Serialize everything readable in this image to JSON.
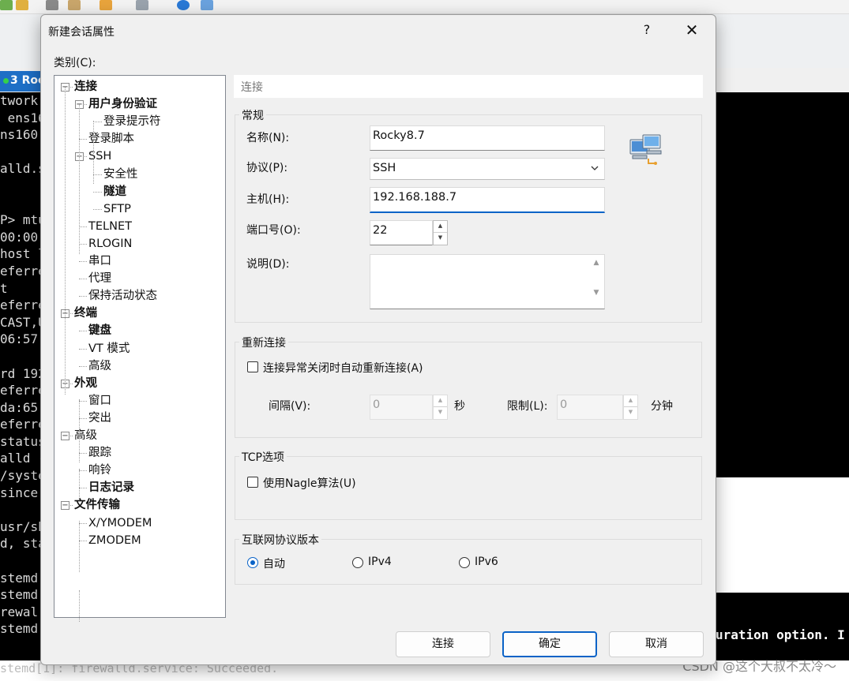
{
  "background": {
    "tab_label": "3 Roc",
    "terminal_lines": [
      "twork",
      " ens16",
      "ns160",
      "",
      "alld.s",
      "",
      "",
      "P> mtu",
      "00:00",
      "host l",
      "eferre",
      "t",
      "eferre",
      "CAST,U",
      "06:57",
      "",
      "rd 192",
      "eferre",
      "da:65",
      "eferre",
      "status",
      "alld -",
      "/syste",
      "since",
      "",
      "usr/sb",
      "d, sta",
      "",
      "stemd",
      "stemd",
      "rewal",
      "stemd"
    ],
    "terminal_bottom": "stemd[1]: firewalld.service: Succeeded.",
    "terminal_right_text": "uration option. I",
    "watermark": "CSDN @这个大叔不太冷～"
  },
  "dialog": {
    "title": "新建会话属性",
    "help_glyph": "?",
    "close_glyph": "✕",
    "category_label": "类别(C):",
    "tree": [
      {
        "label": "连接",
        "bold": true,
        "level": 0,
        "expander": "minus"
      },
      {
        "label": "用户身份验证",
        "bold": true,
        "level": 1,
        "expander": "minus"
      },
      {
        "label": "登录提示符",
        "bold": false,
        "level": 2
      },
      {
        "label": "登录脚本",
        "bold": false,
        "level": 1
      },
      {
        "label": "SSH",
        "bold": false,
        "level": 1,
        "expander": "minus"
      },
      {
        "label": "安全性",
        "bold": false,
        "level": 2
      },
      {
        "label": "隧道",
        "bold": true,
        "level": 2
      },
      {
        "label": "SFTP",
        "bold": false,
        "level": 2
      },
      {
        "label": "TELNET",
        "bold": false,
        "level": 1
      },
      {
        "label": "RLOGIN",
        "bold": false,
        "level": 1
      },
      {
        "label": "串口",
        "bold": false,
        "level": 1
      },
      {
        "label": "代理",
        "bold": false,
        "level": 1
      },
      {
        "label": "保持活动状态",
        "bold": false,
        "level": 1
      },
      {
        "label": "终端",
        "bold": true,
        "level": 0,
        "expander": "minus"
      },
      {
        "label": "键盘",
        "bold": true,
        "level": 1
      },
      {
        "label": "VT 模式",
        "bold": false,
        "level": 1
      },
      {
        "label": "高级",
        "bold": false,
        "level": 1
      },
      {
        "label": "外观",
        "bold": true,
        "level": 0,
        "expander": "minus"
      },
      {
        "label": "窗口",
        "bold": false,
        "level": 1
      },
      {
        "label": "突出",
        "bold": false,
        "level": 1
      },
      {
        "label": "高级",
        "bold": false,
        "level": 0,
        "expander": "minus"
      },
      {
        "label": "跟踪",
        "bold": false,
        "level": 1
      },
      {
        "label": "响铃",
        "bold": false,
        "level": 1
      },
      {
        "label": "日志记录",
        "bold": true,
        "level": 1
      },
      {
        "label": "文件传输",
        "bold": true,
        "level": 0,
        "expander": "minus"
      },
      {
        "label": "X/YMODEM",
        "bold": false,
        "level": 1
      },
      {
        "label": "ZMODEM",
        "bold": false,
        "level": 1
      }
    ],
    "header": "连接",
    "general": {
      "group_label": "常规",
      "name_label": "名称(N):",
      "name_value": "Rocky8.7",
      "protocol_label": "协议(P):",
      "protocol_value": "SSH",
      "host_label": "主机(H):",
      "host_value": "192.168.188.7",
      "port_label": "端口号(O):",
      "port_value": "22",
      "desc_label": "说明(D):",
      "desc_value": ""
    },
    "reconnect": {
      "group_label": "重新连接",
      "checkbox_label": "连接异常关闭时自动重新连接(A)",
      "checked": false,
      "interval_label": "间隔(V):",
      "interval_value": "0",
      "interval_unit": "秒",
      "limit_label": "限制(L):",
      "limit_value": "0",
      "limit_unit": "分钟"
    },
    "tcp": {
      "group_label": "TCP选项",
      "nagle_label": "使用Nagle算法(U)",
      "checked": false
    },
    "ip_version": {
      "group_label": "互联网协议版本",
      "options": [
        "自动",
        "IPv4",
        "IPv6"
      ],
      "selected": "自动"
    },
    "buttons": {
      "connect": "连接",
      "ok": "确定",
      "cancel": "取消"
    }
  }
}
